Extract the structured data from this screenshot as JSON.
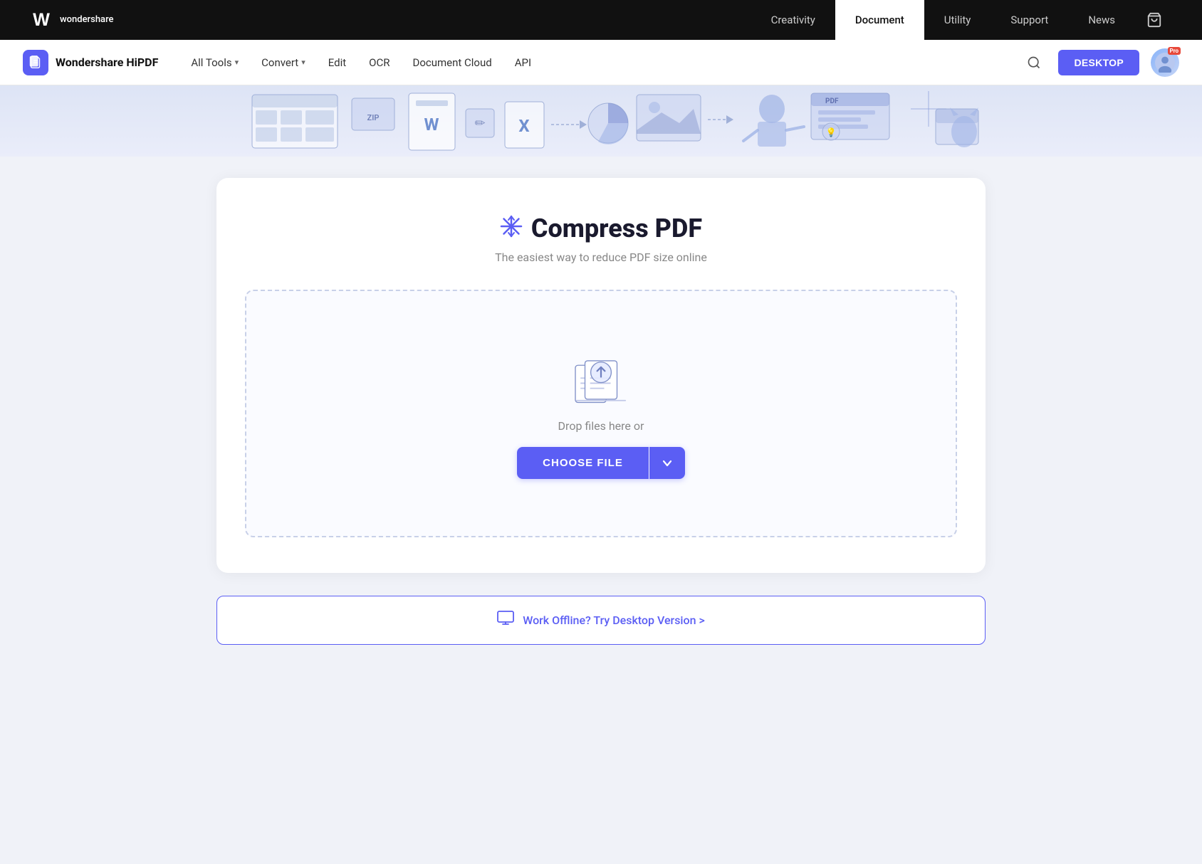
{
  "topnav": {
    "logo_line1": "wondershare",
    "items": [
      {
        "id": "creativity",
        "label": "Creativity",
        "active": false
      },
      {
        "id": "document",
        "label": "Document",
        "active": true
      },
      {
        "id": "utility",
        "label": "Utility",
        "active": false
      },
      {
        "id": "support",
        "label": "Support",
        "active": false
      },
      {
        "id": "news",
        "label": "News",
        "active": false
      }
    ]
  },
  "subnav": {
    "brand": "Wondershare HiPDF",
    "links": [
      {
        "id": "all-tools",
        "label": "All Tools",
        "has_dropdown": true
      },
      {
        "id": "convert",
        "label": "Convert",
        "has_dropdown": true
      },
      {
        "id": "edit",
        "label": "Edit",
        "has_dropdown": false
      },
      {
        "id": "ocr",
        "label": "OCR",
        "has_dropdown": false
      },
      {
        "id": "document-cloud",
        "label": "Document Cloud",
        "has_dropdown": false
      },
      {
        "id": "api",
        "label": "API",
        "has_dropdown": false
      }
    ],
    "desktop_btn": "DESKTOP",
    "pro_badge": "Pro"
  },
  "hero": {
    "alt": "PDF tools illustration"
  },
  "compress": {
    "title": "Compress PDF",
    "subtitle": "The easiest way to reduce PDF size online",
    "drop_text": "Drop files here or",
    "choose_file_btn": "CHOOSE FILE",
    "offline_text": "Work Offline? Try Desktop Version >"
  },
  "colors": {
    "primary": "#5b5ef4",
    "dark": "#111111",
    "text": "#333333"
  }
}
